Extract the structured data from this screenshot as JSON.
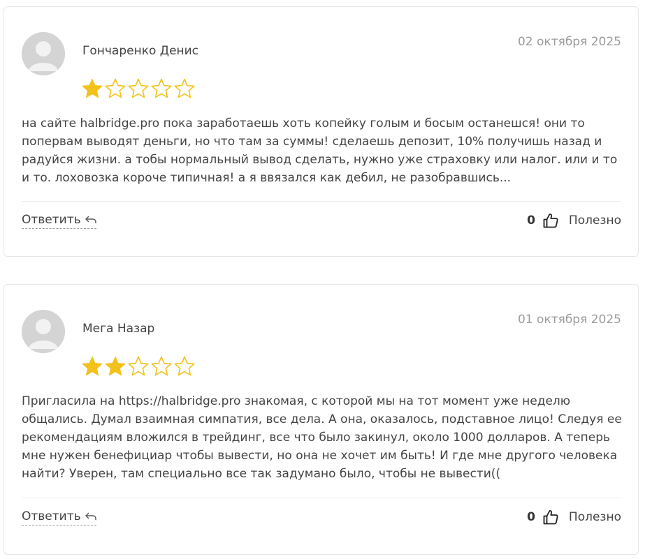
{
  "colors": {
    "star_filled": "#f2c21b",
    "star_outline": "#f2c21b",
    "border": "#e6e6e6",
    "date": "#9b9b9b",
    "text": "#444444"
  },
  "reviews": [
    {
      "author": "Гончаренко Денис",
      "date": "02 октября 2025",
      "rating": 1,
      "rating_max": 5,
      "text": "на сайте halbridge.pro пока заработаешь хоть копейку голым и босым останешся! они то попервам выводят деньги, но что там за суммы! сделаешь депозит, 10% получишь назад и радуйся жизни. а тобы нормальный вывод сделать, нужно уже страховку или налог. или и то и то. лоховозка короче типичная! а я ввязался как дебил, не разобравшись...",
      "reply_label": "Ответить",
      "useful_count": "0",
      "useful_label": "Полезно",
      "icons": {
        "avatar": "user-avatar-icon",
        "reply": "reply-arrow-icon",
        "like": "thumbs-up-icon"
      }
    },
    {
      "author": "Мега Назар",
      "date": "01 октября 2025",
      "rating": 2,
      "rating_max": 5,
      "text": "Пригласила на https://halbridge.pro знакомая, с которой мы на тот момент уже неделю общались. Думал взаимная симпатия, все дела. А она, оказалось, подставное лицо! Следуя ее рекомендациям вложился в трейдинг, все что было закинул, около 1000 долларов. А теперь мне нужен бенефициар чтобы вывести, но она не хочет им быть! И где мне другого человека найти? Уверен, там специально все так задумано было, чтобы не вывести((",
      "reply_label": "Ответить",
      "useful_count": "0",
      "useful_label": "Полезно",
      "icons": {
        "avatar": "user-avatar-icon",
        "reply": "reply-arrow-icon",
        "like": "thumbs-up-icon"
      }
    }
  ]
}
